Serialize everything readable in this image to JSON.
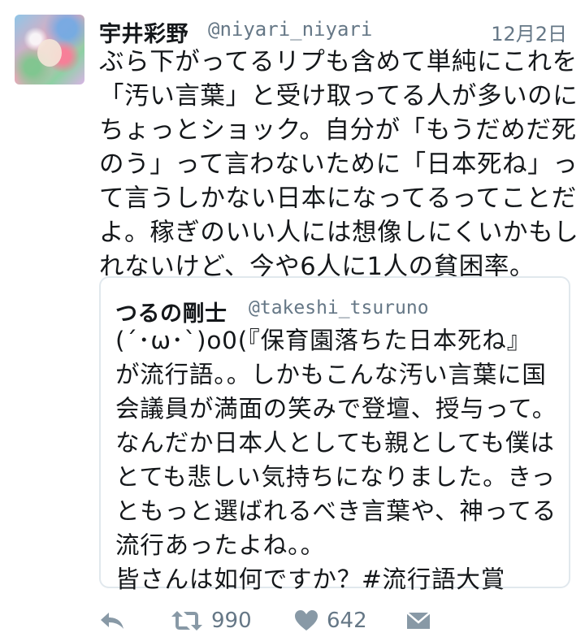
{
  "tweet": {
    "display_name": "宇井彩野",
    "handle": "@niyari_niyari",
    "timestamp": "12月2日",
    "text_lines": [
      "ぶら下がってるリプも含めて単純にこれを",
      "「汚い言葉」と受け取ってる人が多いのに",
      "ちょっとショック。自分が「もうだめだ死",
      "のう」って言わないために「日本死ね」っ",
      "て言うしかない日本になってるってことだ",
      "よ。稼ぎのいい人には想像しにくいかもし",
      "れないけど、今や6人に1人の貧困率。"
    ]
  },
  "quoted_tweet": {
    "display_name": "つるの剛士",
    "handle": "@takeshi_tsuruno",
    "text_lines": [
      "(´･ω･`)o0(『保育園落ちた日本死ね』",
      "が流行語。。しかもこんな汚い言葉に国",
      "会議員が満面の笑みで登壇、授与って。",
      "なんだか日本人としても親としても僕は",
      "とても悲しい気持ちになりました。きっ",
      "ともっと選ばれるべき言葉や、神ってる",
      "流行あったよね。。",
      "皆さんは如何ですか？#流行語大賞"
    ]
  },
  "actions": {
    "reply_icon": "reply-icon",
    "retweet_icon": "retweet-icon",
    "retweet_count": "990",
    "like_icon": "heart-icon",
    "like_count": "642",
    "dm_icon": "envelope-icon"
  },
  "colors": {
    "text": "#14171a",
    "secondary": "#657786",
    "icon": "#8899a6",
    "border": "#e1e8ed"
  }
}
